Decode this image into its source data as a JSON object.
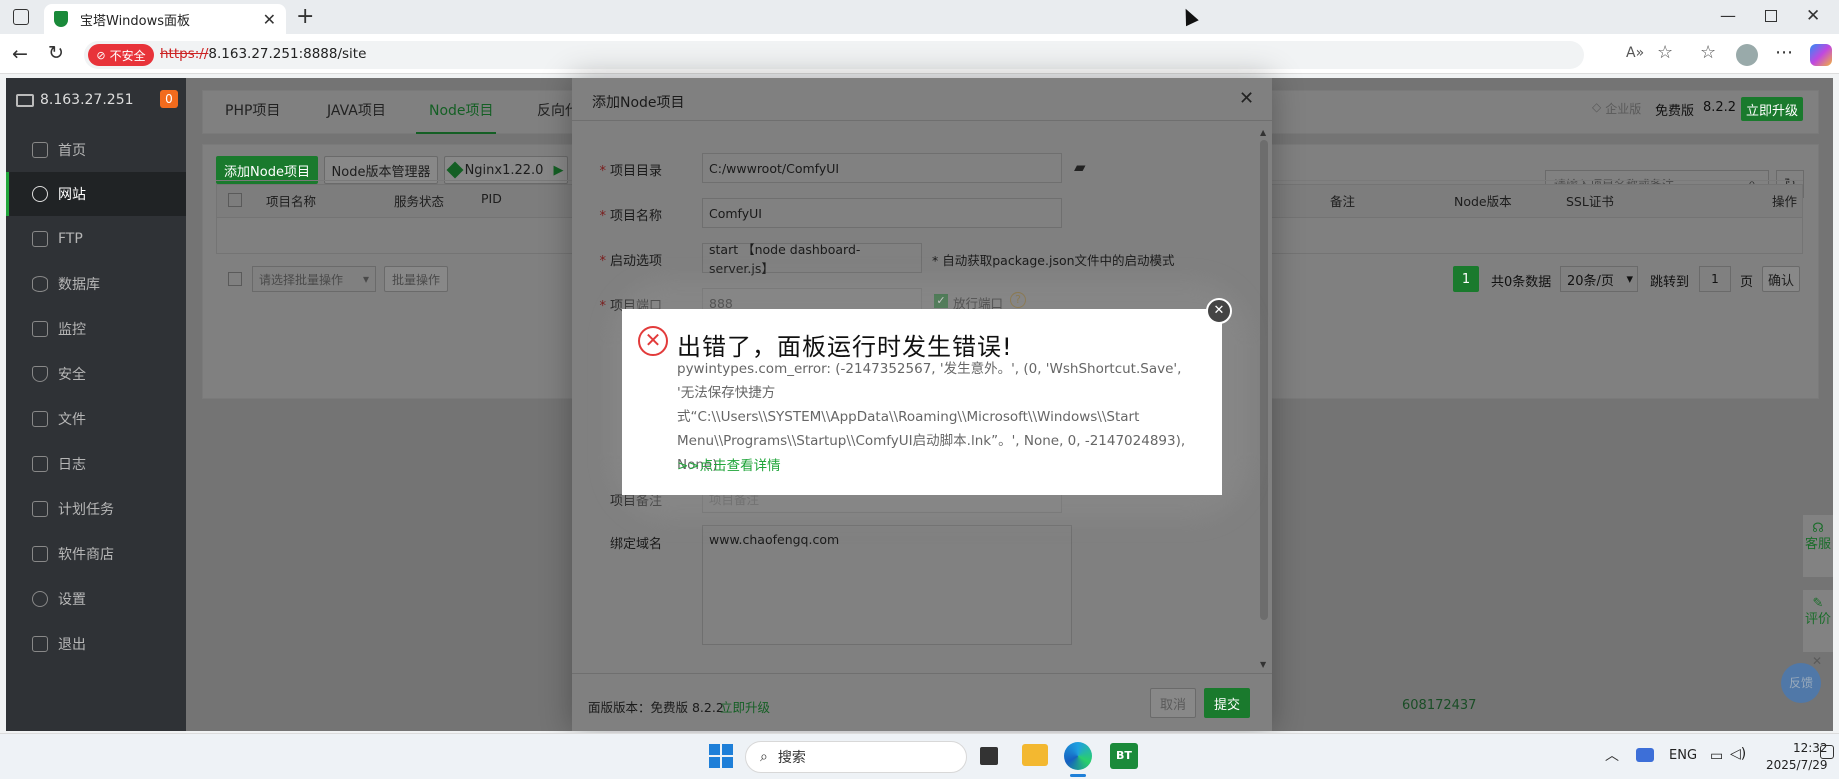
{
  "browser": {
    "tab_title": "宝塔Windows面板",
    "insecure_label": "不安全",
    "url_scheme": "https://",
    "url_rest": "8.163.27.251:8888/site"
  },
  "sidebar": {
    "host": "8.163.27.251",
    "badge": "0",
    "items": [
      {
        "label": "首页"
      },
      {
        "label": "网站"
      },
      {
        "label": "FTP"
      },
      {
        "label": "数据库"
      },
      {
        "label": "监控"
      },
      {
        "label": "安全"
      },
      {
        "label": "文件"
      },
      {
        "label": "日志"
      },
      {
        "label": "计划任务"
      },
      {
        "label": "软件商店"
      },
      {
        "label": "设置"
      },
      {
        "label": "退出"
      }
    ]
  },
  "header": {
    "tabs": [
      "PHP项目",
      "JAVA项目",
      "Node项目",
      "反向代"
    ],
    "enterprise": "企业版",
    "edition": "免费版",
    "version": "8.2.2",
    "upgrade": "立即升级"
  },
  "toolbar": {
    "add_node": "添加Node项目",
    "node_manager": "Node版本管理器",
    "nginx": "Nginx1.22.0",
    "search_placeholder": "请输入项目名称或备注"
  },
  "table": {
    "headers": [
      "项目名称",
      "服务状态",
      "PID",
      "备注",
      "Node版本",
      "SSL证书",
      "操作"
    ]
  },
  "pager": {
    "batch_select": "请选择批量操作",
    "batch_btn": "批量操作",
    "page": "1",
    "total": "共0条数据",
    "per_page": "20条/页",
    "jump": "跳转到",
    "jump_page": "1",
    "page_unit": "页",
    "confirm": "确认"
  },
  "modal": {
    "title": "添加Node项目",
    "fields": {
      "dir_label": "项目目录",
      "dir_value": "C:/wwwroot/ComfyUI",
      "name_label": "项目名称",
      "name_value": "ComfyUI",
      "start_label": "启动选项",
      "start_value": "start 【node dashboard-server.js】",
      "start_hint": "* 自动获取package.json文件中的启动模式",
      "port_label": "项目端口",
      "port_value": "888",
      "open_port": "放行端口",
      "remark_label": "项目备注",
      "remark_placeholder": "项目备注",
      "domain_label": "绑定域名",
      "domain_value": "www.chaofengq.com"
    },
    "footer_version_label": "面版版本：免费版  8.2.2",
    "footer_upgrade": "立即升级",
    "cancel": "取消",
    "submit": "提交",
    "qq": "608172437"
  },
  "error": {
    "title": "出错了，面板运行时发生错误!",
    "message": "pywintypes.com_error: (-2147352567, '发生意外。', (0, 'WshShortcut.Save', '无法保存快捷方式“C:\\\\Users\\\\SYSTEM\\\\AppData\\\\Roaming\\\\Microsoft\\\\Windows\\\\Start Menu\\\\Programs\\\\Startup\\\\ComfyUI启动脚本.lnk”。', None, 0, -2147024893), None)",
    "link": ">>点击查看详情"
  },
  "float": {
    "service": "客服",
    "review": "评价",
    "feedback": "反馈"
  },
  "taskbar": {
    "search": "搜索",
    "lang": "ENG",
    "time": "12:32",
    "date": "2025/7/29"
  }
}
